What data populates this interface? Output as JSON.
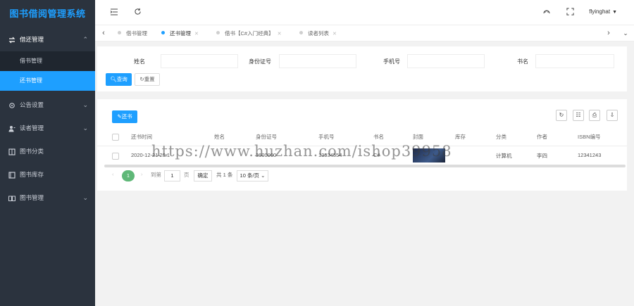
{
  "app": {
    "title": "图书借阅管理系统"
  },
  "sidebar": {
    "items": [
      {
        "label": "借还管理",
        "icon": "swap-icon",
        "expanded": true,
        "children": [
          {
            "label": "借书管理",
            "active": false
          },
          {
            "label": "还书管理",
            "active": true
          }
        ]
      },
      {
        "label": "公告设置",
        "icon": "gear-icon",
        "expanded": false
      },
      {
        "label": "读者管理",
        "icon": "user-icon",
        "expanded": false
      },
      {
        "label": "图书分类",
        "icon": "book-icon",
        "expanded": false
      },
      {
        "label": "图书库存",
        "icon": "book-icon",
        "expanded": false
      },
      {
        "label": "图书管理",
        "icon": "book-open-icon",
        "expanded": false
      }
    ]
  },
  "header": {
    "user": "flyinghat"
  },
  "tabs": [
    {
      "label": "借书管理",
      "active": false,
      "closable": false
    },
    {
      "label": "还书管理",
      "active": true,
      "closable": true
    },
    {
      "label": "借书【C#入门经典】",
      "active": false,
      "closable": true
    },
    {
      "label": "读者列表",
      "active": false,
      "closable": true
    }
  ],
  "search": {
    "fields": [
      {
        "label": "姓名"
      },
      {
        "label": "身份证号"
      },
      {
        "label": "手机号"
      },
      {
        "label": "书名"
      }
    ],
    "query_label": "查询",
    "reset_label": "重置"
  },
  "table": {
    "action_label": "还书",
    "columns": [
      "还书时间",
      "姓名",
      "身份证号",
      "手机号",
      "书名",
      "封面",
      "库存",
      "分类",
      "作者",
      "ISBN编号"
    ],
    "rows": [
      {
        "cells": [
          "2020-12-21 20:1",
          "·",
          "3600000",
          "13934554",
          "C#",
          "",
          "",
          "计算机",
          "李四",
          "12341243"
        ]
      }
    ]
  },
  "pagination": {
    "current": "1",
    "goto_label": "到第",
    "page_input": "1",
    "page_unit": "页",
    "confirm_label": "确定",
    "total": "共 1 条",
    "page_size": "10 条/页"
  },
  "watermark": "https://www.huzhan.com/ishop39958",
  "colors": {
    "primary": "#1e9fff",
    "sidebar_bg": "#2b333e",
    "pager_active": "#5fb878"
  }
}
